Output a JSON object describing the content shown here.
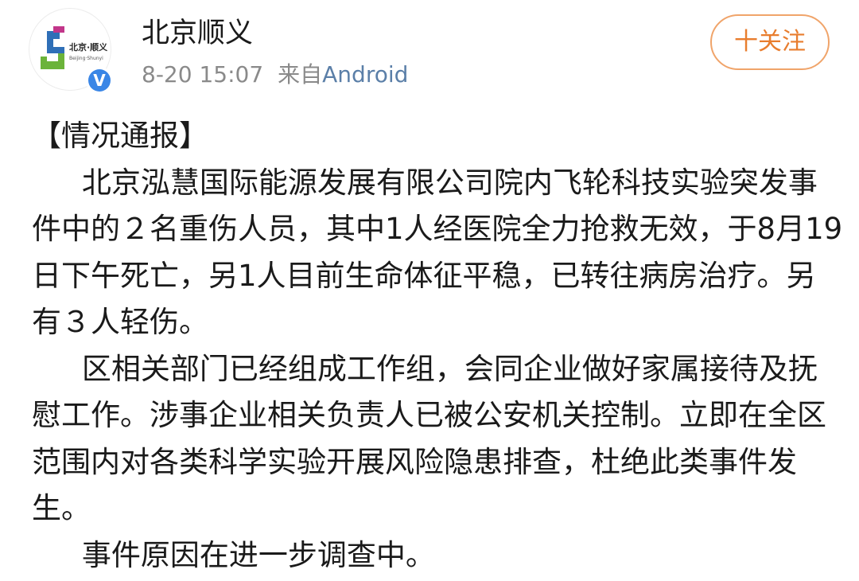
{
  "account": {
    "name": "北京顺义",
    "logo_text": "北京·顺义",
    "logo_subtext": "Beijing·Shunyi",
    "verified_mark": "V",
    "timestamp": "8-20 15:07",
    "source_prefix": "来自",
    "source_name": "Android"
  },
  "follow_button": {
    "label": "十关注"
  },
  "post": {
    "title": "【情况通报】",
    "paragraphs": [
      "北京泓慧国际能源发展有限公司院内飞轮科技实验突发事件中的２名重伤人员，其中1人经医院全力抢救无效，于8月19日下午死亡，另1人目前生命体征平稳，已转往病房治疗。另有３人轻伤。",
      "区相关部门已经组成工作组，会同企业做好家属接待及抚慰工作。涉事企业相关负责人已被公安机关控制。立即在全区范围内对各类科学实验开展风险隐患排查，杜绝此类事件发生。",
      "事件原因在进一步调查中。"
    ]
  },
  "colors": {
    "follow_accent": "#e87d2e",
    "verified_blue": "#3a86e6",
    "logo_blue": "#2f6fb7",
    "logo_green": "#6bb33a",
    "logo_magenta": "#c2368a"
  }
}
